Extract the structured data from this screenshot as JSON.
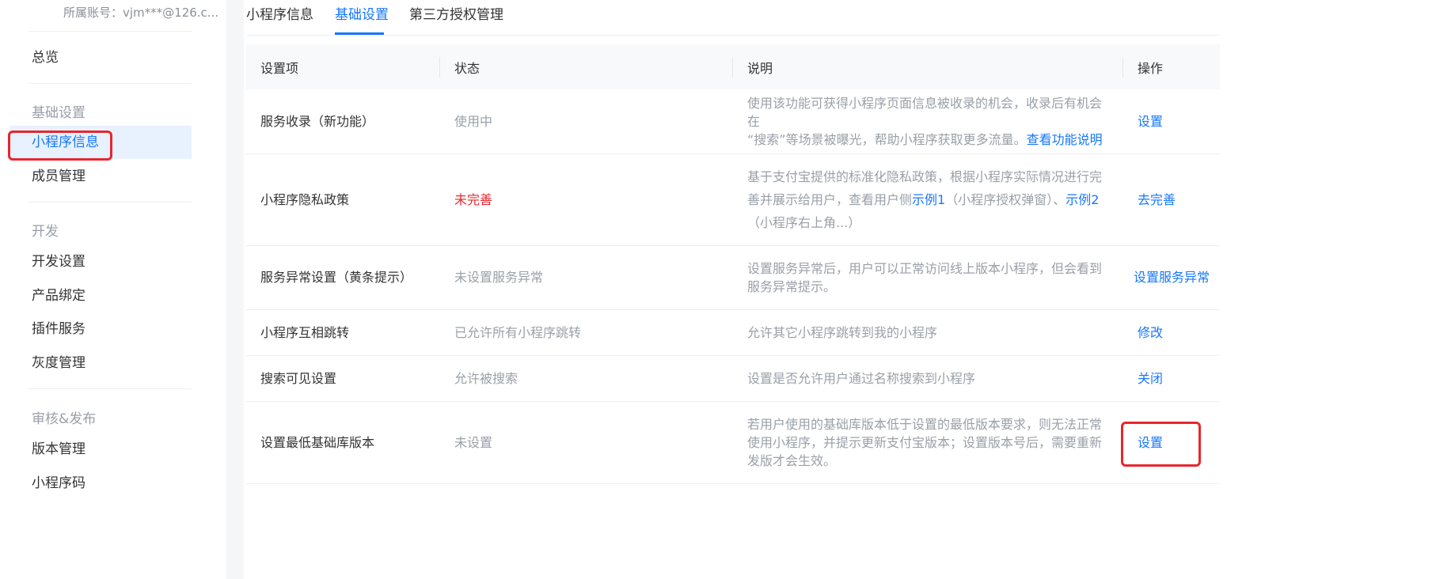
{
  "account": {
    "cropped_top": "…… ……",
    "label": "所属账号：vjm***@126.c..."
  },
  "sidebar": {
    "overview": "总览",
    "groups": [
      {
        "title": "基础设置",
        "items": [
          "小程序信息",
          "成员管理"
        ]
      },
      {
        "title": "开发",
        "items": [
          "开发设置",
          "产品绑定",
          "插件服务",
          "灰度管理"
        ]
      },
      {
        "title": "审核&发布",
        "items": [
          "版本管理",
          "小程序码"
        ]
      }
    ],
    "active_item": "小程序信息"
  },
  "tabs": [
    {
      "label": "小程序信息",
      "active": false
    },
    {
      "label": "基础设置",
      "active": true
    },
    {
      "label": "第三方授权管理",
      "active": false
    }
  ],
  "table": {
    "headers": [
      "设置项",
      "状态",
      "说明",
      "操作"
    ],
    "rows": [
      {
        "item": "服务收录（新功能）",
        "status": "使用中",
        "desc": [
          "使用该功能可获得小程序页面信息被收录的机会，收录后有机会在",
          "“搜索”等场景被曝光，帮助小程序获取更多流量。"
        ],
        "desc_link": "查看功能说明",
        "action": "设置"
      },
      {
        "item": "小程序隐私政策",
        "status": "未完善",
        "desc_parts": [
          "基于支付宝提供的标准化隐私政策，根据小程序实际情况进行完善并展示给用户，查看用户侧",
          "示例1",
          "（小程序授权弹窗）、",
          "示例2",
          "（小程序右上角...）"
        ],
        "action": "去完善"
      },
      {
        "item": "服务异常设置（黄条提示）",
        "status": "未设置服务异常",
        "desc": "设置服务异常后，用户可以正常访问线上版本小程序，但会看到服务异常提示。",
        "action": "设置服务异常"
      },
      {
        "item": "小程序互相跳转",
        "status": "已允许所有小程序跳转",
        "desc": "允许其它小程序跳转到我的小程序",
        "action": "修改"
      },
      {
        "item": "搜索可见设置",
        "status": "允许被搜索",
        "desc": "设置是否允许用户通过名称搜索到小程序",
        "action": "关闭"
      },
      {
        "item": "设置最低基础库版本",
        "status": "未设置",
        "desc": "若用户使用的基础库版本低于设置的最低版本要求，则无法正常使用小程序，并提示更新支付宝版本；设置版本号后，需要重新发版才会生效。",
        "action": "设置"
      }
    ]
  },
  "colors": {
    "accent": "#1677ff",
    "warning": "#e8262d",
    "muted": "#9aa0a8",
    "active_bg": "#e8f2fe",
    "highlight_box": "#e8262d"
  }
}
